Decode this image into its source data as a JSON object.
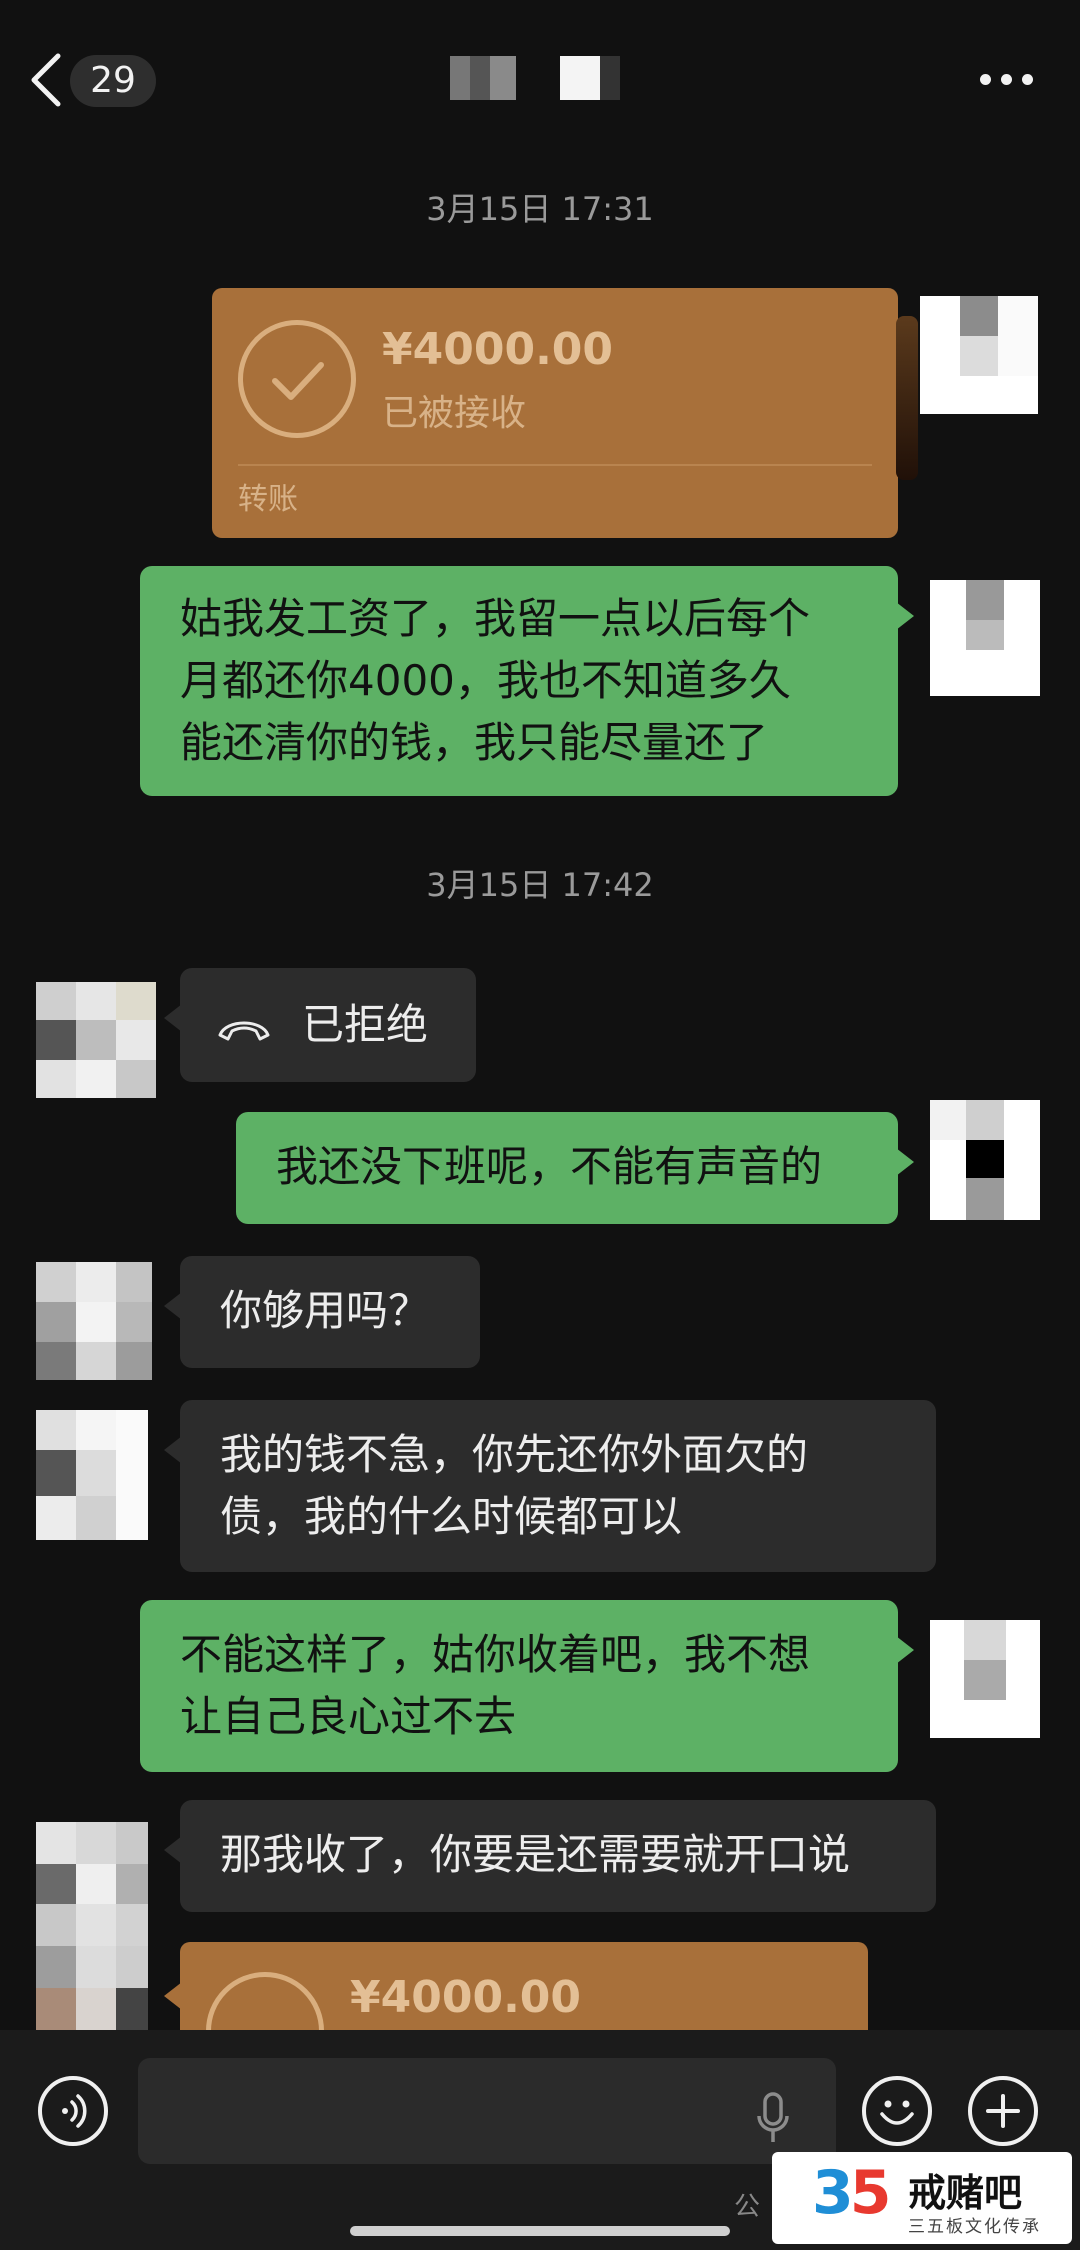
{
  "header": {
    "back_count": "29",
    "title": ""
  },
  "messages": {
    "ts1": "3月15日 17:31",
    "transfer1": {
      "amount": "¥4000.00",
      "status": "已被接收",
      "kind": "转账"
    },
    "msg1_line1": "姑我发工资了，我留一点以后每个",
    "msg1_line2": "月都还你4000，我也不知道多久",
    "msg1_line3": "能还清你的钱，我只能尽量还了",
    "ts2": "3月15日 17:42",
    "call_status": "已拒绝",
    "msg2": "我还没下班呢，不能有声音的",
    "msg3": "你够用吗？",
    "msg4_line1": "我的钱不急，你先还你外面欠的",
    "msg4_line2": "债，我的什么时候都可以",
    "msg5_line1": "不能这样了，姑你收着吧，我不想",
    "msg5_line2": "让自己良心过不去",
    "msg6": "那我收了，你要是还需要就开口说",
    "transfer2": {
      "amount": "¥4000.00"
    }
  },
  "input_bar": {
    "placeholder": "",
    "icons": [
      "voice-icon",
      "microphone-icon",
      "emoji-icon",
      "plus-icon"
    ]
  },
  "watermark": {
    "logo_digit_a": "3",
    "logo_digit_b": "5",
    "brand": "戒赌吧",
    "tagline": "三五板文化传承",
    "prefix": "公"
  },
  "colors": {
    "background": "#111111",
    "sent_bubble": "#5db165",
    "received_bubble": "#2c2c2c",
    "transfer_card": "#a8703a"
  }
}
